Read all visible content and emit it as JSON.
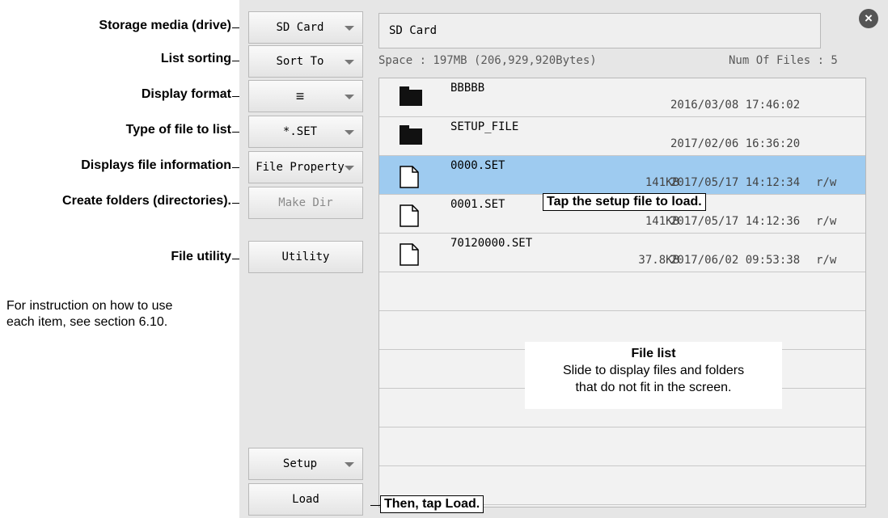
{
  "annotations": {
    "storage_media": "Storage media (drive)",
    "list_sorting": "List sorting",
    "display_format": "Display format",
    "file_type": "Type of file to list",
    "file_info": "Displays file information",
    "create_folders": "Create folders (directories).",
    "file_utility": "File utility",
    "instruction_line1": "For instruction on how to use",
    "instruction_line2": "each item, see section 6.10.",
    "tap_setup": "Tap the setup file to load.",
    "tap_load": "Then, tap Load.",
    "file_list_title": "File list",
    "file_list_line1": "Slide to display files and folders",
    "file_list_line2": "that do not fit in the screen."
  },
  "buttons": {
    "drive": "SD Card",
    "sort": "Sort To",
    "display_format": "≡",
    "file_type": "*.SET",
    "file_property": "File Property",
    "make_dir": "Make Dir",
    "utility": "Utility",
    "setup": "Setup",
    "load": "Load"
  },
  "path": "SD Card",
  "close_glyph": "×",
  "space": "Space : 197MB (206,929,920Bytes)",
  "num_files": "Num Of Files : 5",
  "files": [
    {
      "name": "BBBBB",
      "type": "folder",
      "size": "",
      "date": "2016/03/08 17:46:02",
      "attr": "",
      "selected": false
    },
    {
      "name": "SETUP_FILE",
      "type": "folder",
      "size": "",
      "date": "2017/02/06 16:36:20",
      "attr": "",
      "selected": false
    },
    {
      "name": "0000.SET",
      "type": "file",
      "size": "141KB",
      "date": "2017/05/17 14:12:34",
      "attr": "r/w",
      "selected": true
    },
    {
      "name": "0001.SET",
      "type": "file",
      "size": "141KB",
      "date": "2017/05/17 14:12:36",
      "attr": "r/w",
      "selected": false
    },
    {
      "name": "70120000.SET",
      "type": "file",
      "size": "37.8KB",
      "date": "2017/06/02 09:53:38",
      "attr": "r/w",
      "selected": false
    }
  ],
  "colors": {
    "selected_row": "#9ecbf0",
    "screen_bg": "#e6e6e6"
  }
}
